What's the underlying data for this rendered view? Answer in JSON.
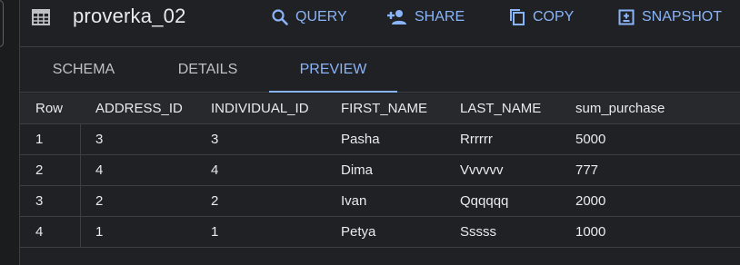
{
  "header": {
    "title": "proverka_02",
    "table_icon": "table-grid-icon",
    "actions": [
      {
        "label": "QUERY",
        "icon": "search-icon"
      },
      {
        "label": "SHARE",
        "icon": "person-add-icon"
      },
      {
        "label": "COPY",
        "icon": "copy-icon"
      },
      {
        "label": "SNAPSHOT",
        "icon": "snapshot-icon"
      }
    ]
  },
  "tabs": [
    {
      "label": "SCHEMA"
    },
    {
      "label": "DETAILS"
    },
    {
      "label": "PREVIEW",
      "active": true
    }
  ],
  "table": {
    "columns": [
      "Row",
      "ADDRESS_ID",
      "INDIVIDUAL_ID",
      "FIRST_NAME",
      "LAST_NAME",
      "sum_purchase"
    ],
    "rows": [
      [
        "1",
        "3",
        "3",
        "Pasha",
        "Rrrrrr",
        "5000"
      ],
      [
        "2",
        "4",
        "4",
        "Dima",
        "Vvvvvv",
        "777"
      ],
      [
        "3",
        "2",
        "2",
        "Ivan",
        "Qqqqqq",
        "2000"
      ],
      [
        "4",
        "1",
        "1",
        "Petya",
        "Sssss",
        "1000"
      ]
    ]
  },
  "colors": {
    "accent": "#8ab4f8",
    "background": "#202124",
    "text": "#e8eaed"
  }
}
